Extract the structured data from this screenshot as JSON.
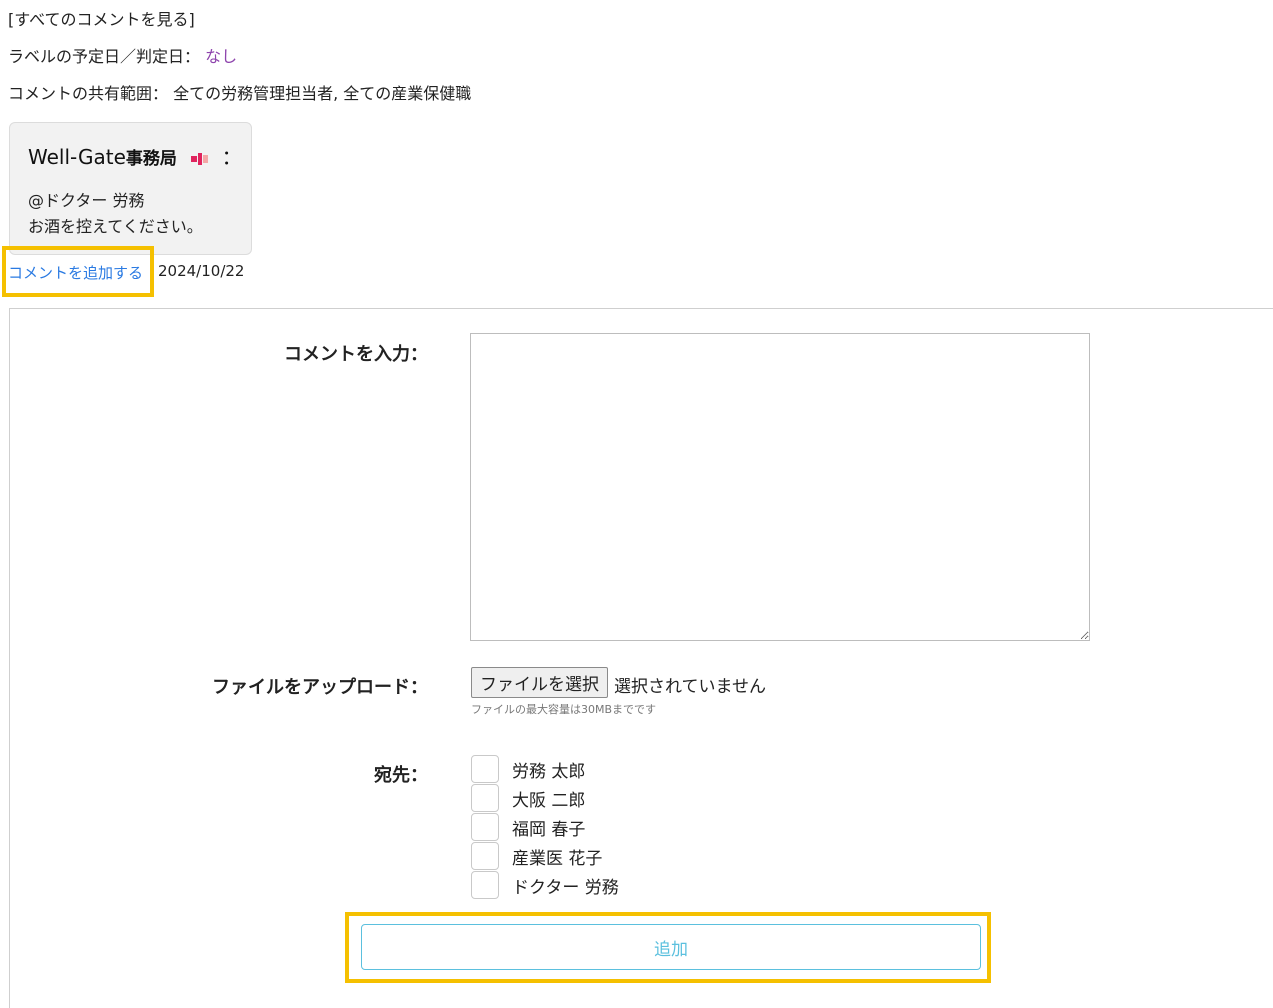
{
  "top": {
    "view_all_link": "[すべてのコメントを見る]",
    "label_date_label": "ラベルの予定日／判定日：",
    "label_date_value": "なし",
    "share_scope_label": "コメントの共有範囲：",
    "share_scope_value": "全ての労務管理担当者, 全ての産業保健職"
  },
  "comment": {
    "author_name": "Well-Gate",
    "author_dept": "事務局",
    "author_suffix": "：",
    "badge_icon": "flag-badge-icon",
    "mention": "@ドクター 労務",
    "body": "お酒を控えてください。",
    "add_comment_link": "コメントを追加する",
    "date": "2024/10/22"
  },
  "form": {
    "comment_label": "コメントを入力：",
    "comment_value": "",
    "upload_label": "ファイルをアップロード：",
    "choose_file_button": "ファイルを選択",
    "file_status": "選択されていません",
    "file_note": "ファイルの最大容量は30MBまでです",
    "recipients_label": "宛先：",
    "recipients": [
      {
        "name": "労務 太郎",
        "checked": false
      },
      {
        "name": "大阪 二郎",
        "checked": false
      },
      {
        "name": "福岡 春子",
        "checked": false
      },
      {
        "name": "産業医 花子",
        "checked": false
      },
      {
        "name": "ドクター 労務",
        "checked": false
      }
    ],
    "submit_button": "追加"
  },
  "colors": {
    "highlight": "#f5c000",
    "link": "#2a7ae2",
    "accent": "#8e44ad",
    "submit": "#5bc0de"
  }
}
